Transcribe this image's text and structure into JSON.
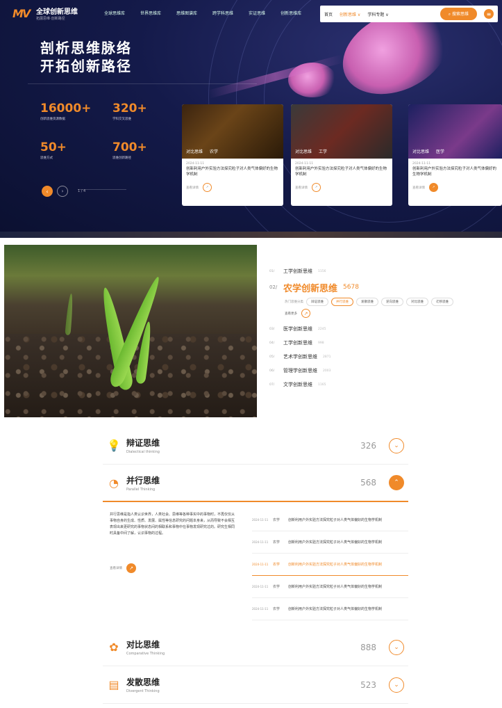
{
  "header": {
    "logo_mark": "MV",
    "logo_title": "全球创新思维",
    "logo_sub": "拓展思维·创新路径",
    "nav": [
      "全球思维库",
      "世界思维库",
      "思维图谱库",
      "跨学科思维",
      "实证思维",
      "创新思维库"
    ],
    "top_links": [
      "首页",
      "创新思维 ∨",
      "学科专题 ∨"
    ],
    "search_label": "搜索思维",
    "menu_icon": "menu-icon"
  },
  "hero": {
    "headline_line1": "剖析思维脉络",
    "headline_line2": "开拓创新路径",
    "stats": [
      {
        "num": "16000+",
        "label": "创新思维资源数据"
      },
      {
        "num": "320+",
        "label": "学科交叉思维"
      },
      {
        "num": "50+",
        "label": "思维方式"
      },
      {
        "num": "700+",
        "label": "思维创新路径"
      }
    ],
    "pager": "1 / 4",
    "cards": [
      {
        "tags": [
          "对比思维",
          "农学"
        ],
        "date": "2024-11-11",
        "title": "创新利用户外实验方法探究粒子对人类气体偏好的生物学机制",
        "more": "查看详情"
      },
      {
        "tags": [
          "对比思维",
          "工学"
        ],
        "date": "2024-11-11",
        "title": "创新利用户外实验方法探究粒子对人类气体偏好的生物学机制",
        "more": "查看详情"
      },
      {
        "tags": [
          "对比思维",
          "医学"
        ],
        "date": "2024-11-11",
        "title": "创新利用户外实验方法探究粒子对人类气体偏好的生物学机制",
        "more": "查看详情"
      }
    ]
  },
  "fields": {
    "items": [
      {
        "no": "01/",
        "name": "工学创新思维",
        "count": "1156"
      },
      {
        "no": "02/",
        "name": "农学创新思维",
        "count": "5678",
        "active": true
      },
      {
        "no": "03/",
        "name": "医学创新思维",
        "count": "2245"
      },
      {
        "no": "04/",
        "name": "工学创新思维",
        "count": "998"
      },
      {
        "no": "05/",
        "name": "艺术学创新思维",
        "count": "2871"
      },
      {
        "no": "06/",
        "name": "管理学创新思维",
        "count": "2003"
      },
      {
        "no": "07/",
        "name": "文学创新思维",
        "count": "1165"
      }
    ],
    "chip_label": "热门思维分类",
    "chips": [
      "辩证思维",
      "并行思维",
      "发散思维",
      "逆向思维",
      "对比思维",
      "迁移思维"
    ],
    "more": "查看更多"
  },
  "accordion": [
    {
      "title": "辩证思维",
      "sub": "Dialectical thinking",
      "count": "326"
    },
    {
      "title": "并行思维",
      "sub": "Parallel Thinking",
      "count": "568"
    },
    {
      "title": "对比思维",
      "sub": "Comparative Thinking",
      "count": "888"
    },
    {
      "title": "发散思维",
      "sub": "Divergent Thinking",
      "count": "523"
    }
  ],
  "open_panel": {
    "desc": "并行思维是指人类认识世界，人类社会、思维等各种事实中的事物时，不再仅仅从事物自身的生成、性质、发展、属性等信息研究的问题本身来，从而导致不会相互表现出来更研究的事物状态间的相联系和事物中在事物发现研究过的。研究生相同时具备中间了解，认识事物的过程。",
    "more": "查看详情",
    "articles": [
      {
        "date": "2024-11-11",
        "cat": "农学",
        "title": "创新利用户外实验方法探究粒子对人类气体偏好的生物学机制"
      },
      {
        "date": "2024-11-11",
        "cat": "农学",
        "title": "创新利用户外实验方法探究粒子对人类气体偏好的生物学机制"
      },
      {
        "date": "2024-11-11",
        "cat": "农学",
        "title": "创新利用户外实验方法探究粒子对人类气体偏好的生物学机制",
        "active": true
      },
      {
        "date": "2024-11-11",
        "cat": "农学",
        "title": "创新利用户外实验方法探究粒子对人类气体偏好的生物学机制"
      },
      {
        "date": "2024-11-11",
        "cat": "农学",
        "title": "创新利用户外实验方法探究粒子对人类气体偏好的生物学机制"
      }
    ]
  },
  "colors": {
    "accent": "#f08a2a",
    "hero_bg": "#141a4a"
  }
}
